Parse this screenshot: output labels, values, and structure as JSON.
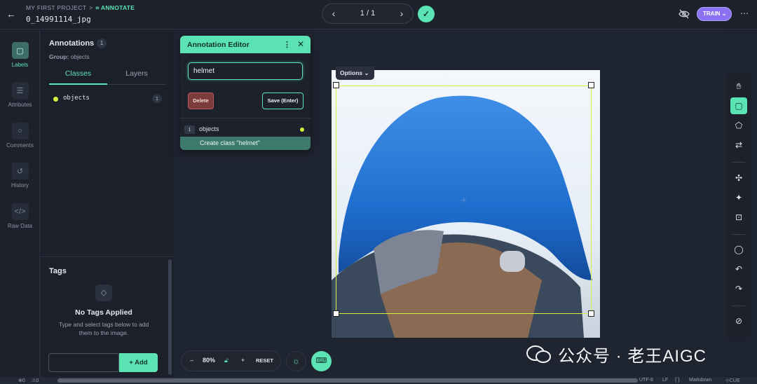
{
  "header": {
    "project": "MY FIRST PROJECT",
    "breadcrumb_sep": ">",
    "mode": "ANNOTATE",
    "filename": "0_14991114_jpg",
    "pager": "1 / 1",
    "train_label": "TRAIN",
    "check_icon": "check-icon",
    "eye_icon": "eye-off-icon"
  },
  "nav": [
    {
      "label": "Labels",
      "icon": "tag-icon",
      "active": true
    },
    {
      "label": "Attributes",
      "icon": "list-icon"
    },
    {
      "label": "Comments",
      "icon": "comment-icon"
    },
    {
      "label": "History",
      "icon": "history-icon"
    },
    {
      "label": "Raw Data",
      "icon": "code-icon"
    }
  ],
  "annotations": {
    "title": "Annotations",
    "count": "1",
    "group_label": "Group:",
    "group_value": "objects",
    "tabs": [
      "Classes",
      "Layers"
    ],
    "classes": [
      {
        "name": "objects",
        "count": "1",
        "color": "#d8f040"
      }
    ]
  },
  "tags": {
    "title": "Tags",
    "empty_title": "No Tags Applied",
    "empty_help": "Type and select tags below to add them to the image.",
    "add_label": "+ Add"
  },
  "canvas": {
    "options_label": "Options"
  },
  "editor": {
    "title": "Annotation Editor",
    "input_value": "helmet",
    "delete_label": "Delete",
    "save_label": "Save (Enter)",
    "row_num": "1",
    "row_label": "objects",
    "create_label": "Create class \"helmet\""
  },
  "zoom": {
    "minus": "–",
    "value": "80%",
    "plus": "+",
    "reset": "RESET"
  },
  "status": {
    "errors": "0",
    "warnings": "0",
    "encoding": "UTF-8",
    "eol": "LF",
    "braces": "{ }",
    "lang": "Markdown",
    "cue": "CUE"
  },
  "watermark": "公众号 · 老王AIGC",
  "colors": {
    "accent": "#5be3b4",
    "train": "#8a72f3",
    "bbox": "#d8f040",
    "delete": "#7d3c3c"
  }
}
